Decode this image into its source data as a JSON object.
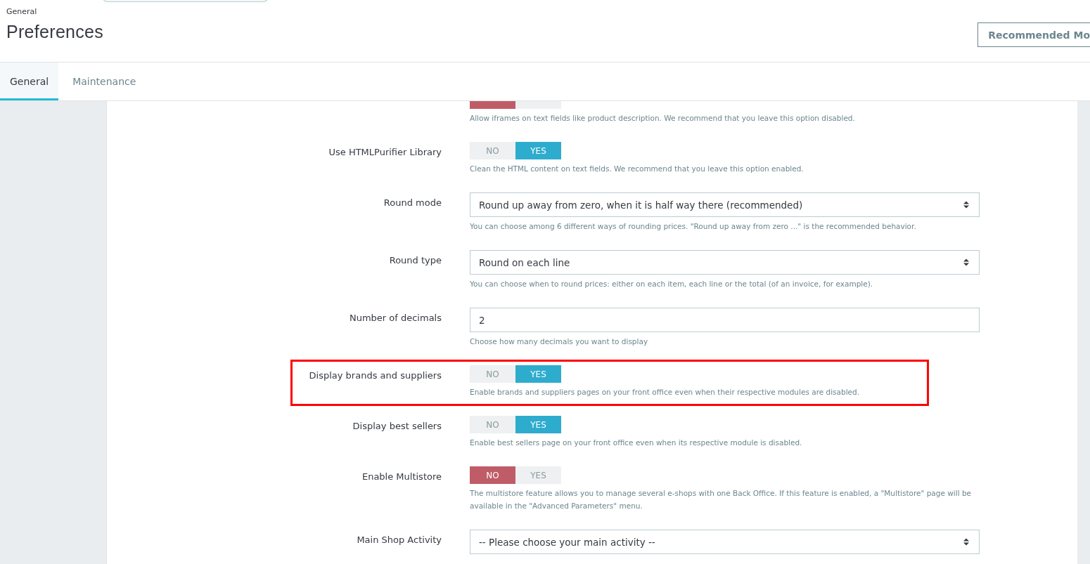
{
  "header": {
    "breadcrumb": "General",
    "title": "Preferences",
    "action_button": "Recommended Mo"
  },
  "tabs": [
    {
      "label": "General",
      "selected": true
    },
    {
      "label": "Maintenance",
      "selected": false
    }
  ],
  "fields": [
    {
      "kind": "toggle",
      "options": [
        {
          "selected": true
        },
        {
          "selected": false
        }
      ],
      "help": "Allow iframes on text fields like product description. We recommend that you leave this option disabled.",
      "highlighted": false
    },
    {
      "kind": "toggle",
      "label": "Use HTMLPurifier Library",
      "options": [
        {
          "label": "NO",
          "selected": false
        },
        {
          "label": "YES",
          "selected": true
        }
      ],
      "help": "Clean the HTML content on text fields. We recommend that you leave this option enabled.",
      "highlighted": false
    },
    {
      "kind": "select",
      "label": "Round mode",
      "value": "Round up away from zero, when it is half way there (recommended)",
      "help": "You can choose among 6 different ways of rounding prices. \"Round up away from zero ...\" is the recommended behavior.",
      "highlighted": false
    },
    {
      "kind": "select",
      "label": "Round type",
      "value": "Round on each line",
      "help": "You can choose when to round prices: either on each item, each line or the total (of an invoice, for example).",
      "highlighted": false
    },
    {
      "kind": "input",
      "label": "Number of decimals",
      "value": "2",
      "help": "Choose how many decimals you want to display",
      "highlighted": false
    },
    {
      "kind": "toggle",
      "label": "Display brands and suppliers",
      "options": [
        {
          "label": "NO",
          "selected": false
        },
        {
          "label": "YES",
          "selected": true
        }
      ],
      "help": "Enable brands and suppliers pages on your front office even when their respective modules are disabled.",
      "highlighted": true
    },
    {
      "kind": "toggle",
      "label": "Display best sellers",
      "options": [
        {
          "label": "NO",
          "selected": false
        },
        {
          "label": "YES",
          "selected": true
        }
      ],
      "help": "Enable best sellers page on your front office even when its respective module is disabled.",
      "highlighted": false
    },
    {
      "kind": "toggle",
      "label": "Enable Multistore",
      "options": [
        {
          "label": "NO",
          "selected": true
        },
        {
          "label": "YES",
          "selected": false
        }
      ],
      "help": "The multistore feature allows you to manage several e-shops with one Back Office. If this feature is enabled, a \"Multistore\" page will be available in the \"Advanced Parameters\" menu.",
      "highlighted": false
    },
    {
      "kind": "select",
      "label": "Main Shop Activity",
      "value": "-- Please choose your main activity --",
      "highlighted": false
    }
  ]
}
